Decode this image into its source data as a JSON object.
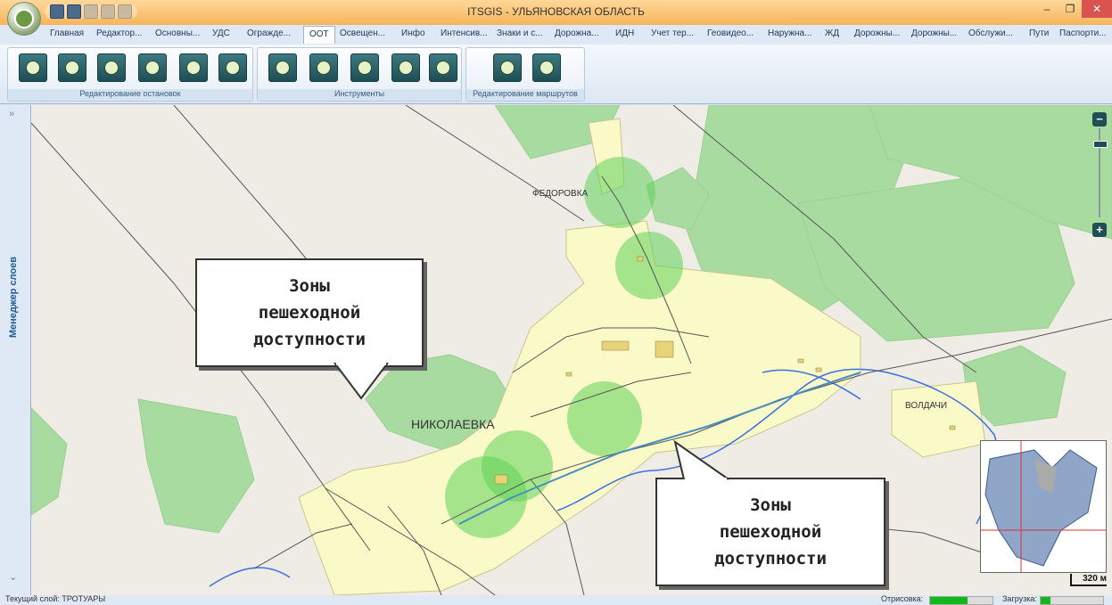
{
  "window": {
    "title": "ITSGIS - УЛЬЯНОВСКАЯ ОБЛАСТЬ",
    "minimize": "–",
    "restore": "❐",
    "close": "✕"
  },
  "tabs": [
    {
      "label": "Главная",
      "active": false
    },
    {
      "label": "Редактор...",
      "active": false
    },
    {
      "label": "Основны...",
      "active": false
    },
    {
      "label": "УДС",
      "active": false
    },
    {
      "label": "Огражде...",
      "active": false
    },
    {
      "label": "ООТ",
      "active": true
    },
    {
      "label": "Освещен...",
      "active": false
    },
    {
      "label": "Инфо",
      "active": false
    },
    {
      "label": "Интенсив...",
      "active": false
    },
    {
      "label": "Знаки и с...",
      "active": false
    },
    {
      "label": "Дорожна...",
      "active": false
    },
    {
      "label": "ИДН",
      "active": false
    },
    {
      "label": "Учет тер...",
      "active": false
    },
    {
      "label": "Геовидео...",
      "active": false
    },
    {
      "label": "Наружна...",
      "active": false
    },
    {
      "label": "ЖД",
      "active": false
    },
    {
      "label": "Дорожны...",
      "active": false
    },
    {
      "label": "Дорожны...",
      "active": false
    },
    {
      "label": "Обслужи...",
      "active": false
    },
    {
      "label": "Пути",
      "active": false
    },
    {
      "label": "Паспорти...",
      "active": false
    }
  ],
  "ribbon": {
    "groups": [
      {
        "label": "Редактирование остановок",
        "buttons": 6
      },
      {
        "label": "Инструменты",
        "buttons": 5
      },
      {
        "label": "Редактирование маршрутов",
        "buttons": 2
      }
    ]
  },
  "sidepanel": {
    "label": "Менеджер слоев",
    "expand": "»",
    "collapse": "⌄"
  },
  "map": {
    "places": {
      "fedorovka": "ФЕДОРОВКА",
      "nikolaevka": "НИКОЛАЕВКА",
      "voldachi": "ВОЛДАЧИ"
    },
    "callout1": {
      "line1": "Зоны",
      "line2": "пешеходной",
      "line3": "доступности"
    },
    "callout2": {
      "line1": "Зоны",
      "line2": "пешеходной",
      "line3": "доступности"
    },
    "zoom_in": "+",
    "zoom_out": "−",
    "scale": "320 м",
    "colors": {
      "forest": "#a8dba0",
      "settlement": "#fafac8",
      "zone": "#5fd25a",
      "water": "#3c6fe0",
      "road": "#555555"
    }
  },
  "status": {
    "layer": "Текущий слой: ТРОТУАРЫ",
    "render_label": "Отрисовка:",
    "render_progress": 0.6,
    "load_label": "Загрузка:",
    "load_progress": 0.15
  }
}
